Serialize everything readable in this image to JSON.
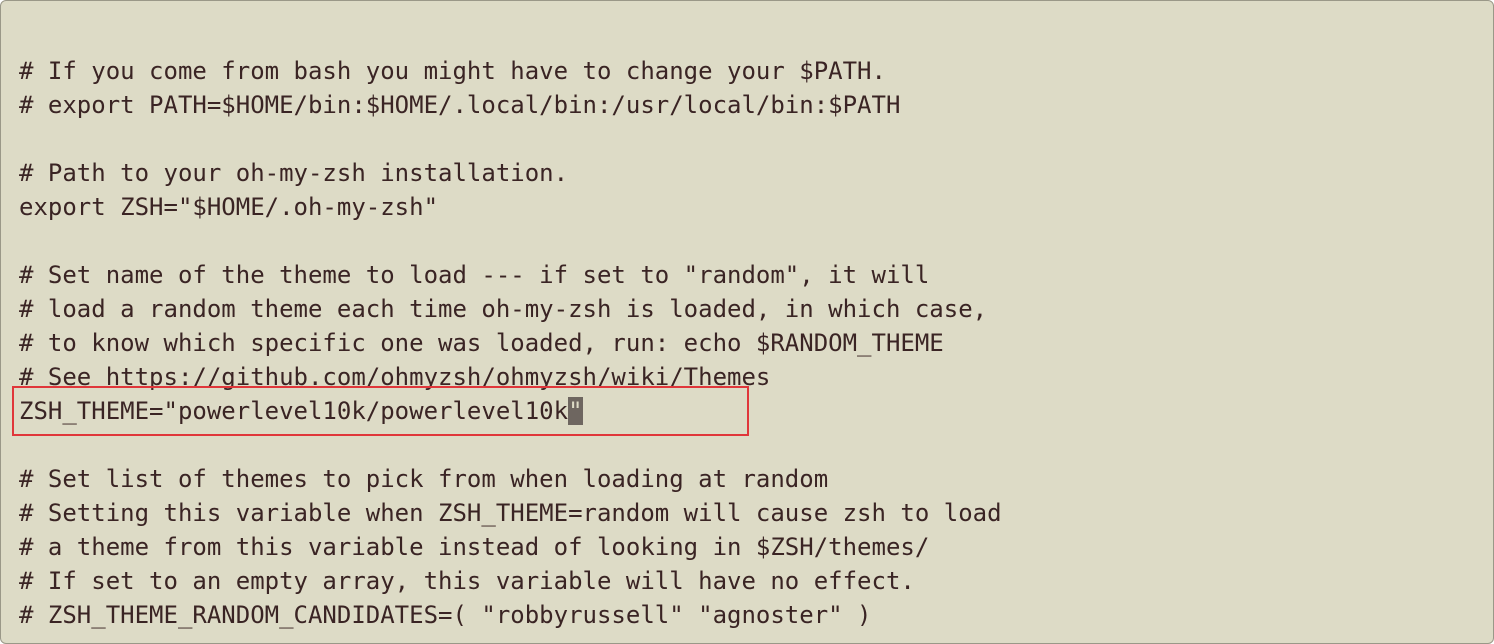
{
  "editor": {
    "lines": [
      "",
      "# If you come from bash you might have to change your $PATH.",
      "# export PATH=$HOME/bin:$HOME/.local/bin:/usr/local/bin:$PATH",
      "",
      "# Path to your oh-my-zsh installation.",
      "export ZSH=\"$HOME/.oh-my-zsh\"",
      "",
      "# Set name of the theme to load --- if set to \"random\", it will",
      "# load a random theme each time oh-my-zsh is loaded, in which case,",
      "# to know which specific one was loaded, run: echo $RANDOM_THEME",
      "# See https://github.com/ohmyzsh/ohmyzsh/wiki/Themes",
      "",
      "",
      "# Set list of themes to pick from when loading at random",
      "# Setting this variable when ZSH_THEME=random will cause zsh to load",
      "# a theme from this variable instead of looking in $ZSH/themes/",
      "# If set to an empty array, this variable will have no effect.",
      "# ZSH_THEME_RANDOM_CANDIDATES=( \"robbyrussell\" \"agnoster\" )"
    ],
    "theme_line": {
      "before_cursor": "ZSH_THEME=\"powerlevel10k/powerlevel10k",
      "cursor_char": "\""
    }
  },
  "colors": {
    "background": "#dddbc6",
    "text": "#3a2424",
    "cursor": "#6e6660",
    "highlight_border": "#e0363a"
  }
}
